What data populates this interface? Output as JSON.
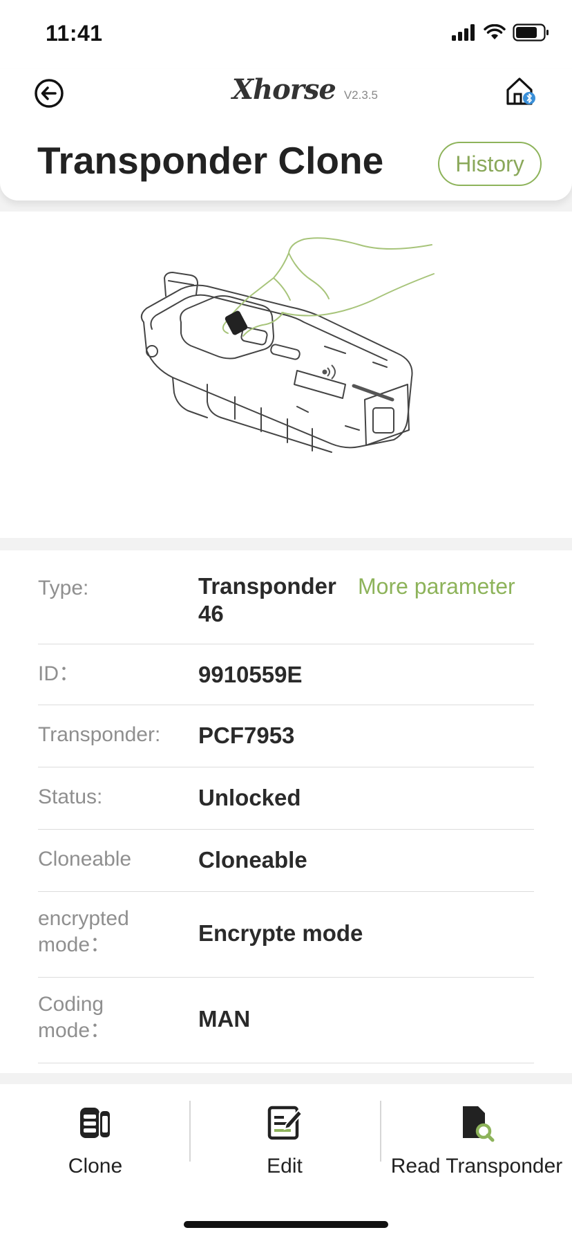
{
  "status_bar": {
    "time": "11:41"
  },
  "header": {
    "brand": "Xhorse",
    "version": "V2.3.5",
    "title": "Transponder Clone",
    "history_label": "History"
  },
  "info": {
    "rows": [
      {
        "label": "Type:",
        "value": "Transponder 46",
        "action": "More parameter"
      },
      {
        "label": "ID：",
        "value": "9910559E"
      },
      {
        "label": "Transponder:",
        "value": "PCF7953"
      },
      {
        "label": "Status:",
        "value": "Unlocked"
      },
      {
        "label": "Cloneable",
        "value": "Cloneable"
      },
      {
        "label": "encrypted mode：",
        "value": "Encrypte mode"
      },
      {
        "label": "Coding mode：",
        "value": "MAN"
      }
    ]
  },
  "bottom_tabs": [
    {
      "label": "Clone",
      "icon": "clone-icon"
    },
    {
      "label": "Edit",
      "icon": "edit-icon"
    },
    {
      "label": "Read Transponder",
      "icon": "read-transponder-icon"
    }
  ],
  "colors": {
    "accent": "#8db35a",
    "label_gray": "#8f8f8f"
  }
}
